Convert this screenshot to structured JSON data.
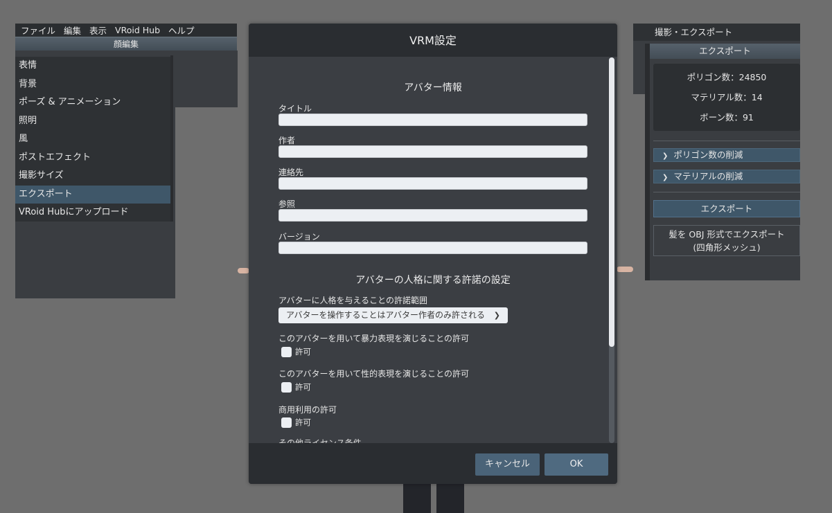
{
  "menu": {
    "items": [
      "ファイル",
      "編集",
      "表示",
      "VRoid Hub",
      "ヘルプ"
    ]
  },
  "left_panel": {
    "header": "顔編集",
    "items": [
      {
        "label": "表情"
      },
      {
        "label": "背景"
      },
      {
        "label": "ポーズ & アニメーション"
      },
      {
        "label": "照明"
      },
      {
        "label": "風"
      },
      {
        "label": "ポストエフェクト"
      },
      {
        "label": "撮影サイズ"
      },
      {
        "label": "エクスポート",
        "active": true
      },
      {
        "label": "VRoid Hubにアップロード"
      }
    ]
  },
  "right_panel": {
    "title": "撮影・エクスポート",
    "header": "エクスポート",
    "stats": {
      "polygons": "ポリゴン数：24850",
      "materials": "マテリアル数：14",
      "bones": "ボーン数：91"
    },
    "collapse_polygons": "ポリゴン数の削減",
    "collapse_materials": "マテリアルの削減",
    "export_button": "エクスポート",
    "hair_export_line1": "髪を OBJ 形式でエクスポート",
    "hair_export_line2": "(四角形メッシュ)"
  },
  "dialog": {
    "title": "VRM設定",
    "avatar_info_title": "アバター情報",
    "fields": {
      "title_label": "タイトル",
      "title_value": "",
      "author_label": "作者",
      "author_value": "",
      "contact_label": "連絡先",
      "contact_value": "",
      "reference_label": "参照",
      "reference_value": "",
      "version_label": "バージョン",
      "version_value": ""
    },
    "permission_title": "アバターの人格に関する許諾の設定",
    "persona_label": "アバターに人格を与えることの許諾範囲",
    "persona_value": "アバターを操作することはアバター作者のみ許される",
    "violence_label": "このアバターを用いて暴力表現を演じることの許可",
    "sexual_label": "このアバターを用いて性的表現を演じることの許可",
    "commercial_label": "商用利用の許可",
    "allow_label": "許可",
    "other_license_label": "その他ライセンス条件",
    "cancel_label": "キャンセル",
    "ok_label": "OK"
  }
}
